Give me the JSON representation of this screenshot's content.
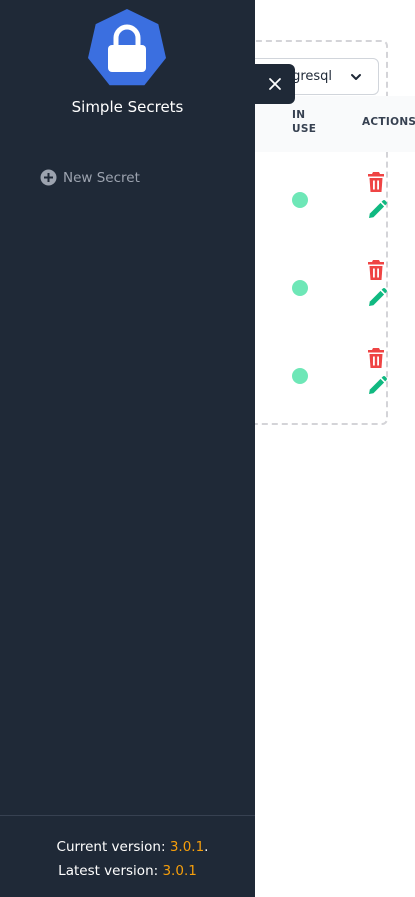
{
  "app": {
    "title": "Simple Secrets",
    "icon": "lock-icon"
  },
  "sidebar": {
    "new_secret_label": "New Secret",
    "new_secret_icon": "plus-circle-icon",
    "version": {
      "current_label": "Current version: ",
      "current_value": "3.0.1",
      "current_suffix": ".",
      "latest_label": "Latest version: ",
      "latest_value": "3.0.1"
    }
  },
  "close_button_icon": "close-icon",
  "main": {
    "namespace_select": {
      "selected": "tgresql"
    },
    "table": {
      "headers": {
        "in_use": "IN USE",
        "actions": "ACTIONS"
      },
      "rows": [
        {
          "in_use": true
        },
        {
          "in_use": true
        },
        {
          "in_use": true
        }
      ]
    }
  },
  "colors": {
    "sidebar_bg": "#1f2937",
    "logo_bg": "#3b6fe0",
    "version_accent": "#f59e0b",
    "status_active": "#6ee7b7",
    "delete_red": "#ef4444",
    "edit_green": "#10b981"
  }
}
